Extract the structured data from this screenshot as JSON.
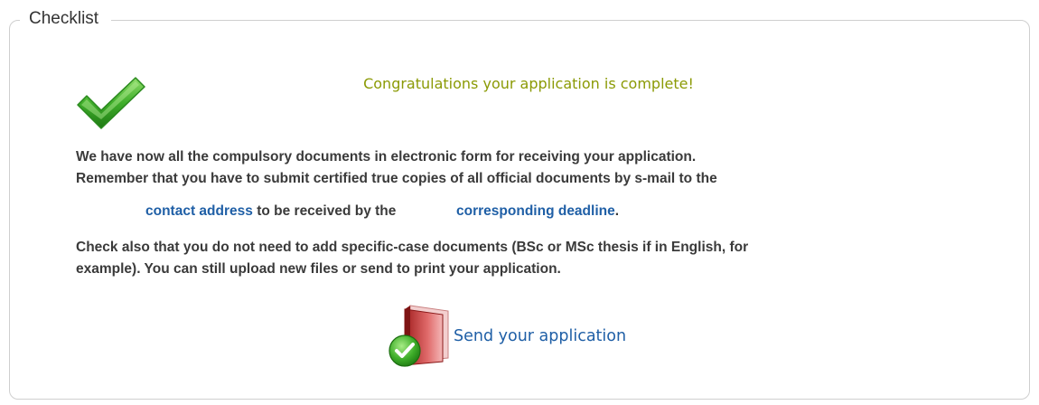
{
  "checklist": {
    "legend": "Checklist",
    "congrats": "Congratulations your application is complete!",
    "paragraph1": {
      "line1": "We have now all the compulsory documents in electronic form for receiving your application.",
      "line2": "Remember that you have to submit certified true copies of all official documents by s-mail to the",
      "contact_link": "contact address",
      "middle_text": "to be received by the",
      "deadline_link": "corresponding deadline",
      "end_text": "."
    },
    "paragraph2": {
      "line1": "Check also that you do not need to add specific-case documents (BSc or MSc thesis if in English, for",
      "line2": "example). You can still upload new files or send to print your application."
    },
    "send_button": {
      "label": "Send your application"
    }
  },
  "icons": {
    "check": "check-mark-icon",
    "send": "send-folder-icon"
  },
  "colors": {
    "congrats": "#8b9a05",
    "link": "#1f5fa6",
    "body_text": "#3a3a3a",
    "check_green": "#3fae2a"
  }
}
